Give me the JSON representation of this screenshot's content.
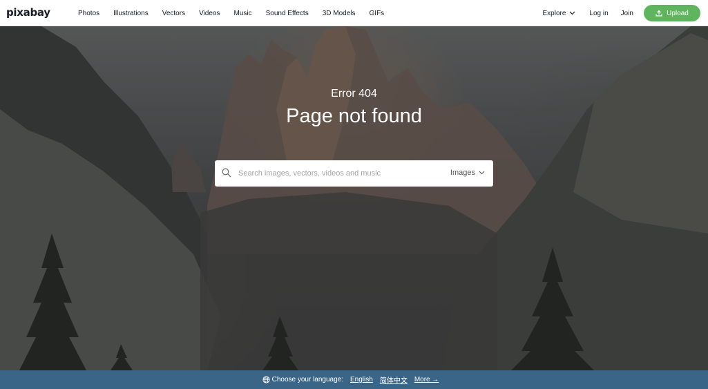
{
  "header": {
    "logo": "pixabay",
    "nav": [
      "Photos",
      "Illustrations",
      "Vectors",
      "Videos",
      "Music",
      "Sound Effects",
      "3D Models",
      "GIFs"
    ],
    "explore": "Explore",
    "login": "Log in",
    "join": "Join",
    "upload": "Upload",
    "upload_color": "#5eb55e"
  },
  "hero": {
    "error_code": "Error 404",
    "title": "Page not found",
    "search_placeholder": "Search images, vectors, videos and music",
    "search_type": "Images"
  },
  "footer": {
    "choose_language": "Choose your language:",
    "languages": [
      "English",
      "简体中文"
    ],
    "more": "More →",
    "bar_color": "#3a6587"
  }
}
